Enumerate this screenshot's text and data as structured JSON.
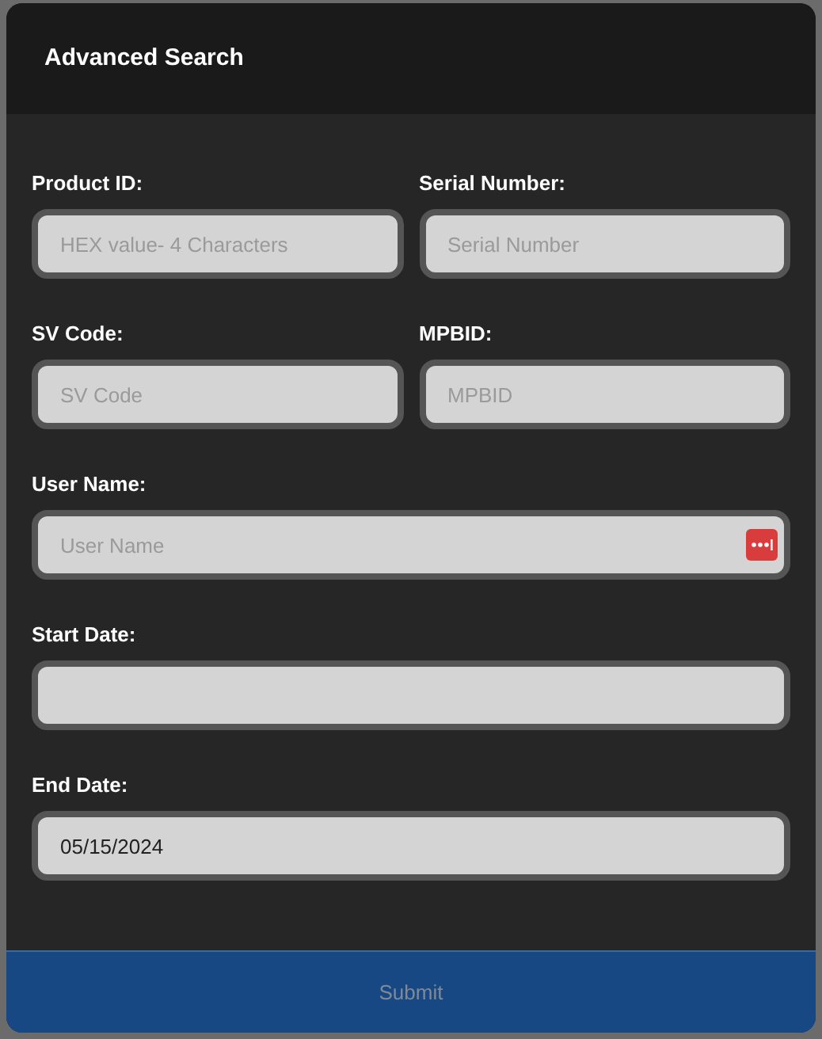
{
  "dialog": {
    "title": "Advanced Search"
  },
  "rows": [
    {
      "fields": [
        {
          "label": "Product ID:",
          "placeholder": "HEX value- 4 Characters"
        },
        {
          "label": "Serial Number:",
          "placeholder": "Serial Number"
        }
      ]
    },
    {
      "fields": [
        {
          "label": "SV Code:",
          "placeholder": "SV Code"
        },
        {
          "label": "MPBID:",
          "placeholder": "MPBID"
        }
      ]
    },
    {
      "fields": [
        {
          "label": "User Name:",
          "placeholder": "User Name",
          "autofill_badge": true
        }
      ]
    },
    {
      "fields": [
        {
          "label": "Start Date:"
        }
      ]
    },
    {
      "fields": [
        {
          "label": "End Date:",
          "value": "05/15/2024"
        }
      ]
    }
  ],
  "submit": {
    "label": "Submit",
    "disabled": true
  }
}
